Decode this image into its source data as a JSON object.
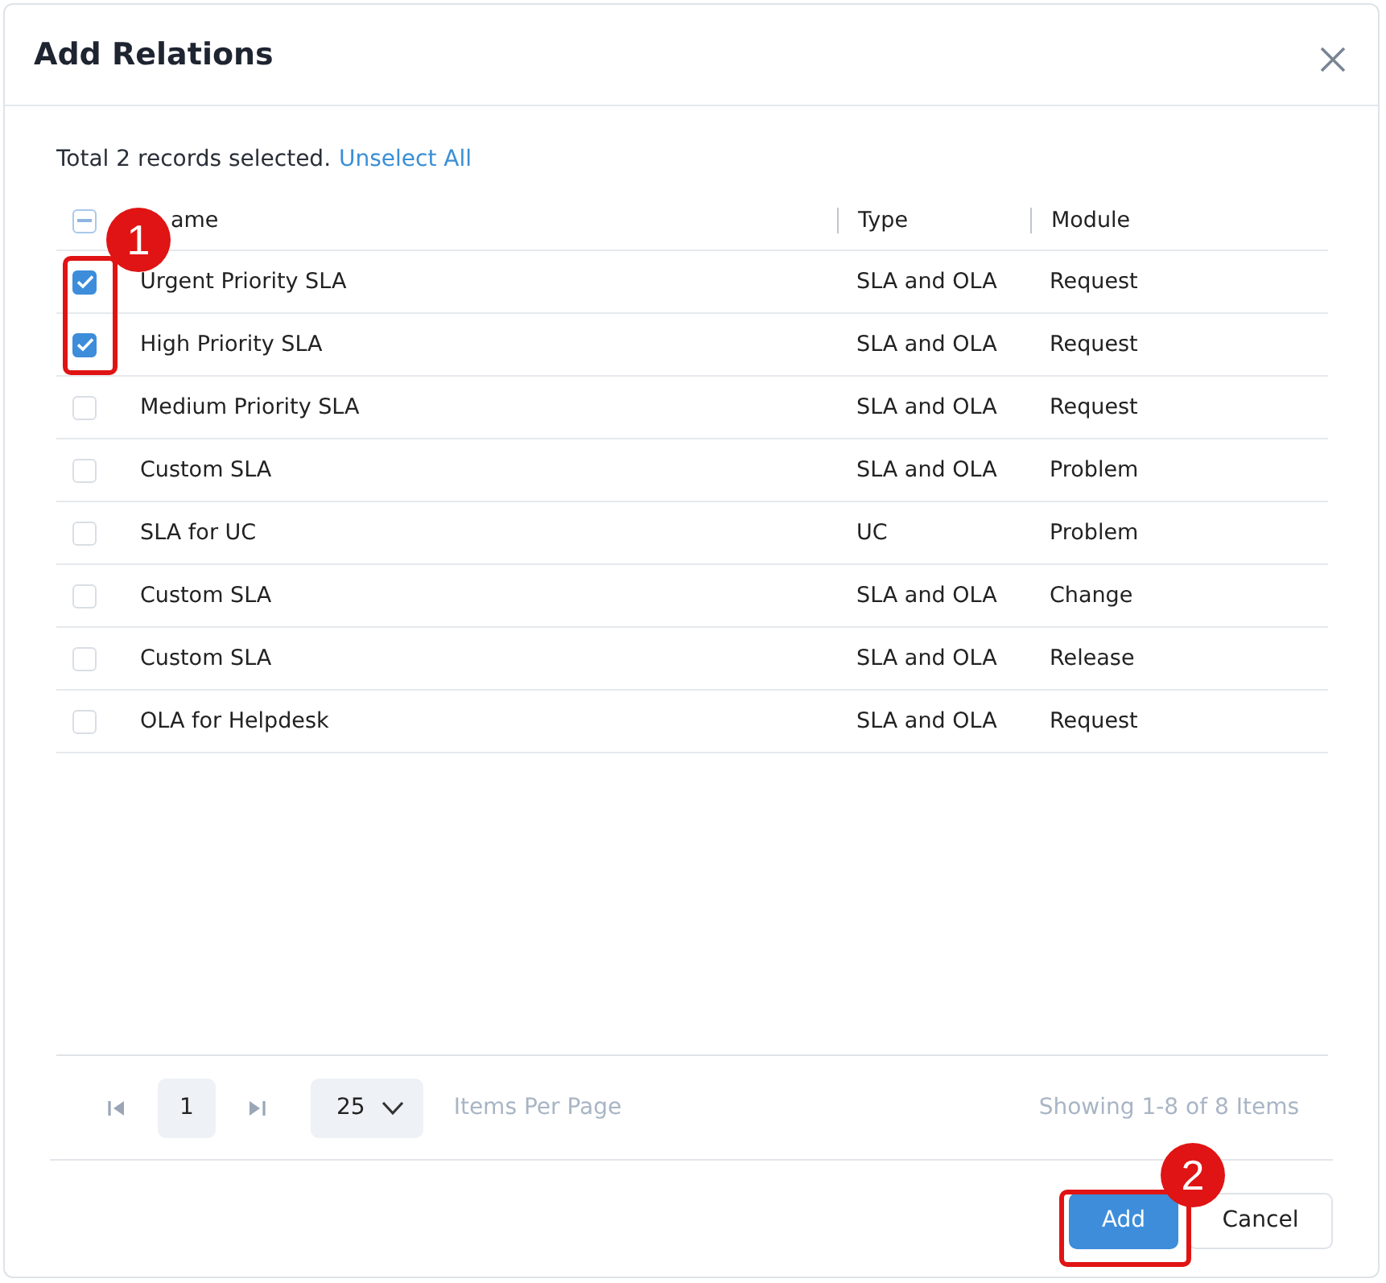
{
  "dialog": {
    "title": "Add Relations"
  },
  "selection": {
    "summary": "Total 2 records selected.",
    "link": "Unselect All"
  },
  "table": {
    "header_checkbox": {
      "indeterminate": true
    },
    "columns": [
      "ame",
      "Type",
      "Module"
    ],
    "rows": [
      {
        "checked": true,
        "name": "Urgent Priority SLA",
        "type": "SLA and OLA",
        "module": "Request"
      },
      {
        "checked": true,
        "name": "High Priority SLA",
        "type": "SLA and OLA",
        "module": "Request"
      },
      {
        "checked": false,
        "name": "Medium Priority SLA",
        "type": "SLA and OLA",
        "module": "Request"
      },
      {
        "checked": false,
        "name": "Custom SLA",
        "type": "SLA and OLA",
        "module": "Problem"
      },
      {
        "checked": false,
        "name": "SLA for UC",
        "type": "UC",
        "module": "Problem"
      },
      {
        "checked": false,
        "name": "Custom SLA",
        "type": "SLA and OLA",
        "module": "Change"
      },
      {
        "checked": false,
        "name": "Custom SLA",
        "type": "SLA and OLA",
        "module": "Release"
      },
      {
        "checked": false,
        "name": "OLA for Helpdesk",
        "type": "SLA and OLA",
        "module": "Request"
      }
    ]
  },
  "pagination": {
    "page": "1",
    "page_size": "25",
    "page_size_label": "Items Per Page",
    "summary": "Showing 1-8 of 8 Items"
  },
  "buttons": [
    {
      "kind": "primary",
      "label": "Add"
    },
    {
      "kind": "secondary",
      "label": "Cancel"
    }
  ],
  "annotations": [
    {
      "label": "1"
    },
    {
      "label": "2"
    }
  ]
}
